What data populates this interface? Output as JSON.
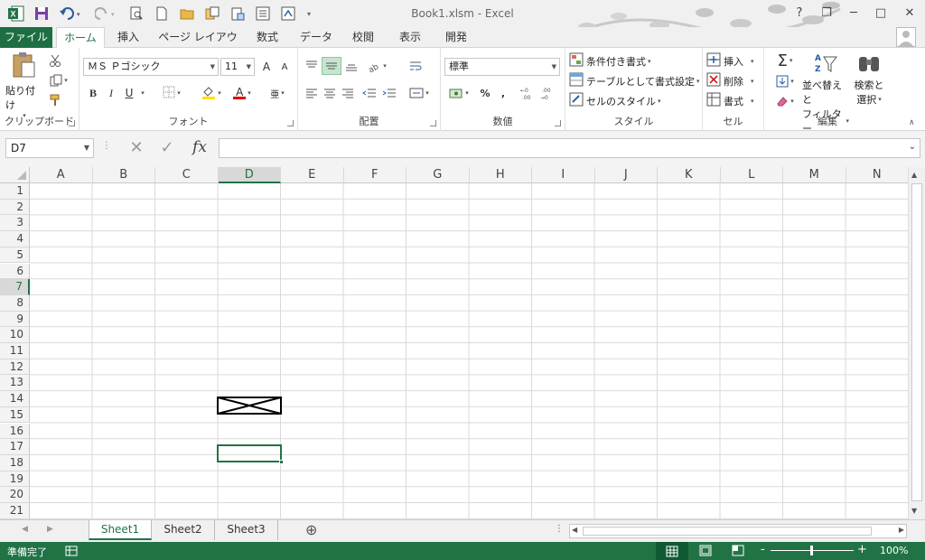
{
  "window": {
    "title": "Book1.xlsm - Excel"
  },
  "quick_access": {
    "icons": [
      "excel-logo-icon",
      "save-icon",
      "undo-icon",
      "redo-icon",
      "print-preview-icon",
      "new-icon",
      "open-icon",
      "copy-icon",
      "paste-icon",
      "form-icon",
      "macro-icon",
      "customize-icon"
    ]
  },
  "window_controls": {
    "help": "?",
    "restore": "❐",
    "minimize": "─",
    "maximize": "□",
    "close": "✕"
  },
  "tabs": [
    "ファイル",
    "ホーム",
    "挿入",
    "ページ レイアウト",
    "数式",
    "データ",
    "校閲",
    "表示",
    "開発"
  ],
  "ribbon": {
    "clipboard": {
      "paste_label": "貼り付け",
      "group_label": "クリップボード"
    },
    "font": {
      "font_name": "ＭＳ Ｐゴシック",
      "font_size": "11",
      "grow": "A",
      "shrink": "A",
      "bold": "B",
      "italic": "I",
      "underline": "U",
      "font_color_glyph": "A",
      "phonetic_glyph": "亜",
      "group_label": "フォント"
    },
    "alignment": {
      "group_label": "配置"
    },
    "number": {
      "format": "標準",
      "percent": "%",
      "comma": ",",
      "group_label": "数値"
    },
    "styles": {
      "conditional": "条件付き書式",
      "table": "テーブルとして書式設定",
      "cell_styles": "セルのスタイル",
      "group_label": "スタイル"
    },
    "cells": {
      "insert": "挿入",
      "delete": "削除",
      "format": "書式",
      "group_label": "セル"
    },
    "editing": {
      "sort_filter_1": "並べ替えと",
      "sort_filter_2": "フィルター",
      "find_select_1": "検索と",
      "find_select_2": "選択",
      "group_label": "編集"
    }
  },
  "formula_bar": {
    "name_box": "D7",
    "cancel": "✕",
    "enter": "✓",
    "fx": "fx",
    "value": ""
  },
  "columns": [
    "A",
    "B",
    "C",
    "D",
    "E",
    "F",
    "G",
    "H",
    "I",
    "J",
    "K",
    "L",
    "M",
    "N"
  ],
  "rows": [
    "1",
    "2",
    "3",
    "4",
    "5",
    "6",
    "7",
    "8",
    "9",
    "10",
    "11",
    "12",
    "13",
    "14",
    "15",
    "16",
    "17",
    "18",
    "19",
    "20",
    "21"
  ],
  "active_cell": {
    "column": "D",
    "row": "7"
  },
  "sheets": [
    "Sheet1",
    "Sheet2",
    "Sheet3"
  ],
  "add_sheet": "⊕",
  "status": {
    "ready": "準備完了",
    "zoom": "100%",
    "zoom_minus": "-",
    "zoom_plus": "+"
  },
  "colors": {
    "accent": "#217346",
    "file_tab": "#1d6f42"
  }
}
